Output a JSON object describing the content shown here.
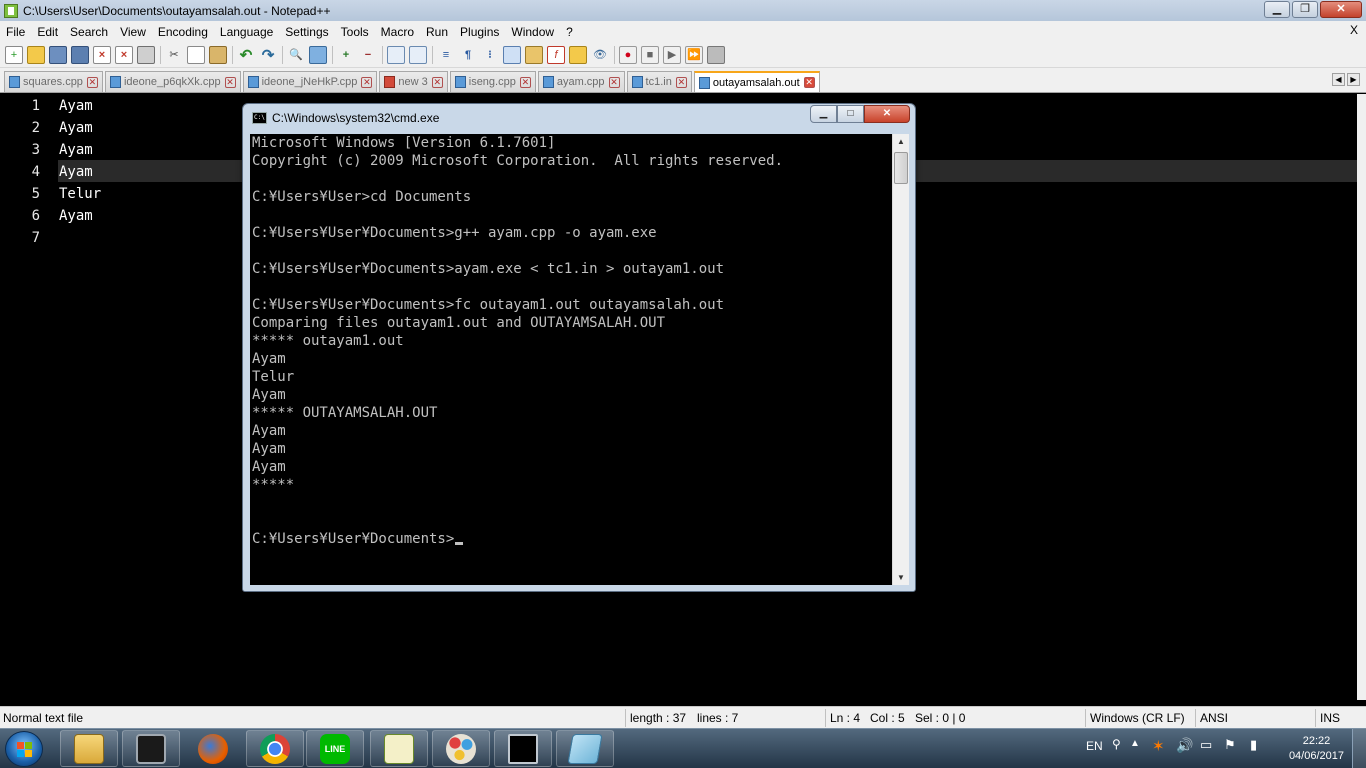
{
  "notepad": {
    "title": "C:\\Users\\User\\Documents\\outayamsalah.out - Notepad++",
    "menu": [
      "File",
      "Edit",
      "Search",
      "View",
      "Encoding",
      "Language",
      "Settings",
      "Tools",
      "Macro",
      "Run",
      "Plugins",
      "Window",
      "?"
    ],
    "menu_close": "X",
    "toolbar_icons": [
      "new-file-icon",
      "open-file-icon",
      "save-icon",
      "save-all-icon",
      "close-icon",
      "close-all-icon",
      "print-icon",
      "cut-icon",
      "copy-icon",
      "paste-icon",
      "undo-icon",
      "redo-icon",
      "find-icon",
      "replace-icon",
      "zoom-in-icon",
      "zoom-out-icon",
      "sync-v-icon",
      "sync-h-icon",
      "wrap-icon",
      "all-chars-icon",
      "indent-guide-icon",
      "udl-icon",
      "doc-map-icon",
      "function-list-icon",
      "folder-workspace-icon",
      "monitor-icon",
      "record-macro-icon",
      "stop-macro-icon",
      "play-macro-icon",
      "run-macro-multiple-icon",
      "save-macro-icon"
    ],
    "tabs": [
      {
        "label": "squares.cpp",
        "active": false
      },
      {
        "label": "ideone_p6qkXk.cpp",
        "active": false
      },
      {
        "label": "ideone_jNeHkP.cpp",
        "active": false
      },
      {
        "label": "new 3",
        "active": false
      },
      {
        "label": "iseng.cpp",
        "active": false
      },
      {
        "label": "ayam.cpp",
        "active": false
      },
      {
        "label": "tc1.in",
        "active": false
      },
      {
        "label": "outayamsalah.out",
        "active": true
      }
    ],
    "line_numbers": [
      "1",
      "2",
      "3",
      "4",
      "5",
      "6",
      "7"
    ],
    "lines": [
      "Ayam",
      "Ayam",
      "Ayam",
      "Ayam",
      "Telur",
      "Ayam",
      ""
    ],
    "status": {
      "file_type": "Normal text file",
      "length": "length : 37",
      "lines": "lines : 7",
      "ln": "Ln : 4",
      "col": "Col : 5",
      "sel": "Sel : 0 | 0",
      "eol": "Windows (CR LF)",
      "encoding": "ANSI",
      "mode": "INS"
    }
  },
  "cmd": {
    "title": "C:\\Windows\\system32\\cmd.exe",
    "lines": [
      "Microsoft Windows [Version 6.1.7601]",
      "Copyright (c) 2009 Microsoft Corporation.  All rights reserved.",
      "",
      "C:¥Users¥User>cd Documents",
      "",
      "C:¥Users¥User¥Documents>g++ ayam.cpp -o ayam.exe",
      "",
      "C:¥Users¥User¥Documents>ayam.exe < tc1.in > outayam1.out",
      "",
      "C:¥Users¥User¥Documents>fc outayam1.out outayamsalah.out",
      "Comparing files outayam1.out and OUTAYAMSALAH.OUT",
      "***** outayam1.out",
      "Ayam",
      "Telur",
      "Ayam",
      "***** OUTAYAMSALAH.OUT",
      "Ayam",
      "Ayam",
      "Ayam",
      "*****",
      "",
      "",
      "C:¥Users¥User¥Documents>"
    ]
  },
  "taskbar": {
    "apps": [
      "start-button",
      "file-explorer-icon",
      "task-manager-icon",
      "firefox-icon",
      "chrome-icon",
      "line-icon",
      "notepadpp-icon",
      "paint-icon",
      "cmd-icon",
      "app-icon"
    ],
    "line_label": "LINE",
    "lang": "EN",
    "time": "22:22",
    "date": "04/06/2017"
  },
  "colors": {
    "editor_bg": "#000000",
    "active_tab_accent": "#f7a61a",
    "taskbar": "#233547"
  }
}
